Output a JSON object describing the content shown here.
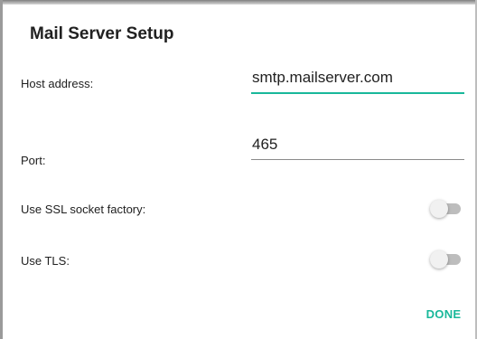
{
  "dialog": {
    "title": "Mail Server Setup",
    "fields": {
      "host": {
        "label": "Host address:",
        "value": "smtp.mailserver.com"
      },
      "port": {
        "label": "Port:",
        "value": "465"
      }
    },
    "toggles": {
      "ssl": {
        "label": "Use SSL socket factory:",
        "checked": false
      },
      "tls": {
        "label": "Use TLS:",
        "checked": false
      }
    },
    "done_label": "DONE"
  },
  "colors": {
    "accent": "#19b89a",
    "switch_track_off": "#bdbdbd",
    "switch_thumb_off": "#f1f1f1"
  }
}
